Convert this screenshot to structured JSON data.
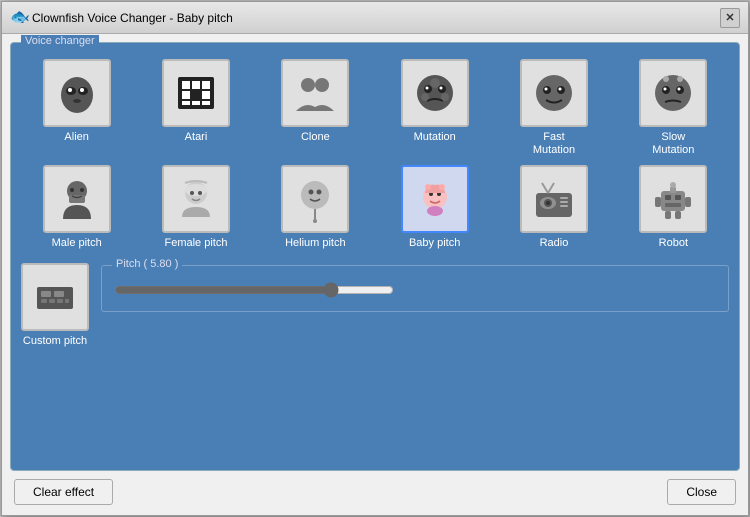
{
  "window": {
    "title": "Clownfish Voice Changer - Baby pitch",
    "icon": "🐟"
  },
  "group_label": "Voice changer",
  "voice_items": [
    {
      "id": "alien",
      "label": "Alien",
      "icon": "alien",
      "selected": false
    },
    {
      "id": "atari",
      "label": "Atari",
      "icon": "atari",
      "selected": false
    },
    {
      "id": "clone",
      "label": "Clone",
      "icon": "clone",
      "selected": false
    },
    {
      "id": "mutation",
      "label": "Mutation",
      "icon": "mutation",
      "selected": false
    },
    {
      "id": "fast-mutation",
      "label": "Fast\nMutation",
      "icon": "fast-mutation",
      "selected": false
    },
    {
      "id": "slow-mutation",
      "label": "Slow\nMutation",
      "icon": "slow-mutation",
      "selected": false
    },
    {
      "id": "male-pitch",
      "label": "Male pitch",
      "icon": "male-pitch",
      "selected": false
    },
    {
      "id": "female-pitch",
      "label": "Female pitch",
      "icon": "female-pitch",
      "selected": false
    },
    {
      "id": "helium-pitch",
      "label": "Helium pitch",
      "icon": "helium-pitch",
      "selected": false
    },
    {
      "id": "baby-pitch",
      "label": "Baby pitch",
      "icon": "baby-pitch",
      "selected": true
    },
    {
      "id": "radio",
      "label": "Radio",
      "icon": "radio",
      "selected": false
    },
    {
      "id": "robot",
      "label": "Robot",
      "icon": "robot",
      "selected": false
    }
  ],
  "custom_pitch": {
    "label": "Custom pitch",
    "icon": "custom-pitch"
  },
  "pitch_slider": {
    "label": "Pitch ( 5.80 )",
    "value": 5.8,
    "min": -10,
    "max": 10,
    "display_value": "5.80"
  },
  "buttons": {
    "clear_effect": "Clear effect",
    "close": "Close"
  }
}
